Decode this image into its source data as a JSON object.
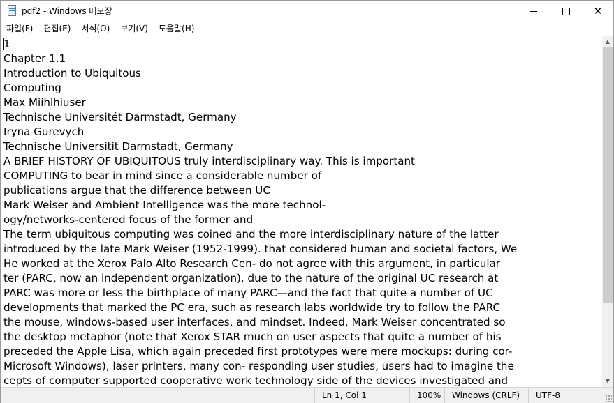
{
  "window": {
    "title": "pdf2 - Windows 메모장",
    "icon": "notepad-icon",
    "controls": {
      "minimize": "minimize-icon",
      "maximize": "maximize-icon",
      "close": "close-icon",
      "close_glyph": "✕"
    }
  },
  "menu": {
    "file": "파일(F)",
    "edit": "편집(E)",
    "format": "서식(O)",
    "view": "보기(V)",
    "help": "도움말(H)"
  },
  "editor": {
    "lines": [
      "1",
      "Chapter 1.1",
      "Introduction to Ubiquitous",
      "Computing",
      "Max Miihlhiuser",
      "Technische Universitét Darmstadt, Germany",
      "Iryna Gurevych",
      "Technische Universitit Darmstadt, Germany",
      "A BRIEF HISTORY OF UBIQUITOUS truly interdisciplinary way. This is important",
      "COMPUTING to bear in mind since a considerable number of",
      "publications argue that the difference between UC",
      "Mark Weiser and Ambient Intelligence was the more technol-",
      "ogy/networks-centered focus of the former and",
      "The term ubiquitous computing was coined and the more interdisciplinary nature of the latter",
      "introduced by the late Mark Weiser (1952-1999). that considered human and societal factors, We",
      "He worked at the Xerox Palo Alto Research Cen- do not agree with this argument, in particular",
      "ter (PARC, now an independent organization). due to the nature of the original UC research at",
      "PARC was more or less the birthplace of many PARC—and the fact that quite a number of UC",
      "developments that marked the PC era, such as research labs worldwide try to follow the PARC",
      "the mouse, windows-based user interfaces, and mindset. Indeed, Mark Weiser concentrated so",
      "the desktop metaphor (note that Xerox STAR much on user aspects that quite a number of his",
      "preceded the Apple Lisa, which again preceded first prototypes were mere mockups: during cor-",
      "Microsoft Windows), laser printers, many con- responding user studies, users had to imagine the",
      "cepts of computer supported cooperative work technology side of the devices investigated and"
    ]
  },
  "scrollbar": {
    "up_glyph": "▲",
    "down_glyph": "▼"
  },
  "status": {
    "position": "Ln 1, Col 1",
    "zoom": "100%",
    "line_ending": "Windows (CRLF)",
    "encoding": "UTF-8"
  }
}
